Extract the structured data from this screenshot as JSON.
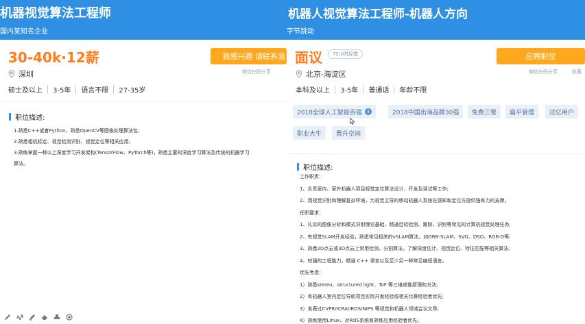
{
  "left_job": {
    "title": "机器视觉算法工程师",
    "company": "国内某知名企业",
    "salary": "30-40k·12薪",
    "interest_button": "我感兴趣 请联系我",
    "share": "微信扫码分享",
    "location": "深圳",
    "requirements": [
      "硕士及以上",
      "3-5年",
      "语言不限",
      "27-35岁"
    ],
    "section_title": "职位描述:",
    "description": [
      "1.熟悉C++或者Python，熟悉OpenCV等图像处理算法包;",
      "2.熟悉相机标定、视觉检测识别、视觉定位等相关应用;",
      "3.熟练掌握一种以上深度学习开发架构(TensorFlow、PyTorch等)，熟悉主要的深度学习算法及传统的机器学习",
      "算法。"
    ]
  },
  "right_job": {
    "title": "机器人视觉算法工程师-机器人方向",
    "company": "字节跳动",
    "salary": "面议",
    "reply_badge": "72小时反馈",
    "apply_button": "应聘职位",
    "share": "微信扫码分享",
    "favorite": "收藏",
    "location": "北京-海淀区",
    "requirements": [
      "本科及以上",
      "3-5年",
      "普通话",
      "年龄不限"
    ],
    "tags": [
      "2018全球人工智能百强",
      "2018中国出海品牌30强",
      "免费三餐",
      "扁平管理",
      "过亿用户",
      "职业大牛",
      "晋升空间"
    ],
    "section_title": "职位描述:",
    "description": [
      "工作职责：",
      "1、负责室内、室外机器人项目视觉定位算法设计、开发及调试等工作;",
      "2、用视觉识别和理解复杂环境，为视觉主导的移动机器人系统在感知和定位方提供强有力的支撑。",
      "任职要求：",
      "1、扎实的图像分析和模式识别理论基础，精通目标检测、跟踪、识别等常见的计算机视觉处理任务;",
      "2、有视觉SLAM开发经验，熟悉常见相关的vSLAM算法，如ORB-SLAM、SVO、DSO、RGB-D等;",
      "3、熟悉2D点云或3D点云上常用检测、分割算法，了解深度估计、视觉定位、特征匹配等相关算法;",
      "4、较强的工程能力，精通 C++ 语言以及至少另一种常见编程语言。",
      "优先考虑：",
      "1）熟悉stereo、structured light、ToF 等三维成像原理和方法;",
      "2）有机器人室内定位导航项目实际开发经验或相关比赛经验者优先;",
      "3）发表过CVPR/ICRA/IROS/NIPS 等视觉和机器人领域会议文章;",
      "4）熟练使用Linux、对ROS系统有熟练应用经验者优先。"
    ]
  },
  "colors": {
    "banner": "#2e8fe3",
    "accent_orange": "#ff7d1e",
    "button_orange": "#ffa81e",
    "tag_bg": "#eaf0f7",
    "tag_text": "#4f7199"
  },
  "icons": {
    "location": "map-pin-icon",
    "info": "info-icon",
    "tools": [
      "pen-icon",
      "squiggle-icon",
      "highlighter-icon",
      "eraser-icon",
      "stamp-icon",
      "record-icon"
    ]
  }
}
